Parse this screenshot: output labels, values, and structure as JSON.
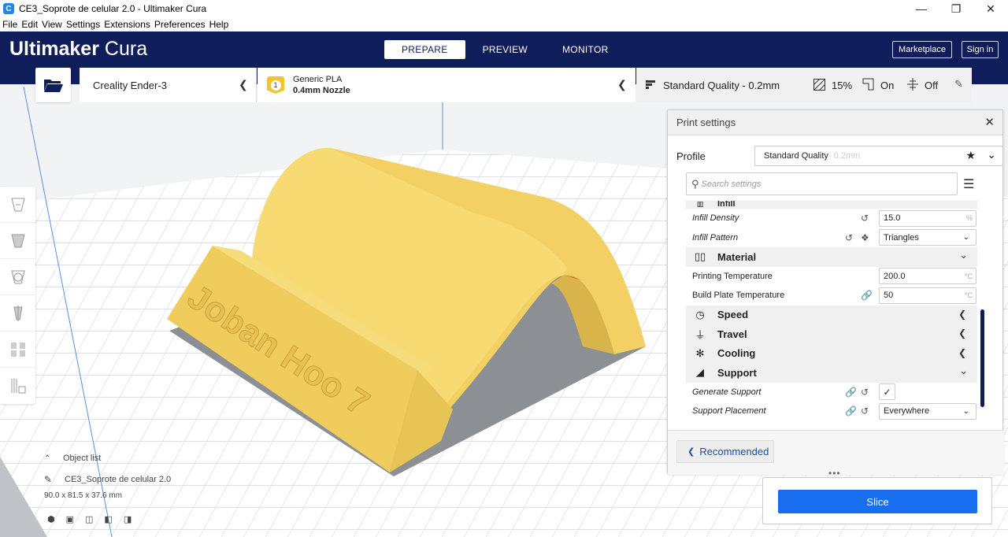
{
  "window": {
    "title": "CE3_Soprote de celular 2.0 - Ultimaker Cura",
    "app_icon_letter": "C",
    "minimize": "—",
    "restore": "❐",
    "close": "✕"
  },
  "menu": [
    "File",
    "Edit",
    "View",
    "Settings",
    "Extensions",
    "Preferences",
    "Help"
  ],
  "header": {
    "logo_bold": "Ultimaker",
    "logo_light": "Cura",
    "tabs": [
      "PREPARE",
      "PREVIEW",
      "MONITOR"
    ],
    "active_tab": "PREPARE",
    "marketplace": "Marketplace",
    "sign_in": "Sign in"
  },
  "toolbar": {
    "machine": "Creality Ender-3",
    "material_badge": "1",
    "material_name": "Generic PLA",
    "nozzle": "0.4mm Nozzle",
    "quality": "Standard Quality - 0.2mm",
    "infill": "15%",
    "support": "On",
    "adhesion": "Off"
  },
  "object_list": {
    "header": "Object list",
    "object_name": "CE3_Soprote de celular 2.0",
    "dimensions": "90.0 x 81.5 x 37.6 mm"
  },
  "print_settings": {
    "title": "Print settings",
    "profile_label": "Profile",
    "profile_value": "Standard Quality",
    "profile_suffix": " - 0.2mm",
    "search_placeholder": "Search settings",
    "partial_category": "Infill",
    "infill_density_label": "Infill Density",
    "infill_density_value": "15.0",
    "infill_density_unit": "%",
    "infill_pattern_label": "Infill Pattern",
    "infill_pattern_value": "Triangles",
    "cat_material": "Material",
    "printing_temp_label": "Printing Temperature",
    "printing_temp_value": "200.0",
    "printing_temp_unit": "°C",
    "bed_temp_label": "Build Plate Temperature",
    "bed_temp_value": "50",
    "bed_temp_unit": "°C",
    "cat_speed": "Speed",
    "cat_travel": "Travel",
    "cat_cooling": "Cooling",
    "cat_support": "Support",
    "generate_support_label": "Generate Support",
    "generate_support_checked": true,
    "support_placement_label": "Support Placement",
    "support_placement_value": "Everywhere",
    "recommended": "Recommended"
  },
  "slice": {
    "button": "Slice"
  },
  "colors": {
    "header_bg": "#0f1e5a",
    "model": "#f5d56a",
    "slice_button": "#196ef0"
  }
}
